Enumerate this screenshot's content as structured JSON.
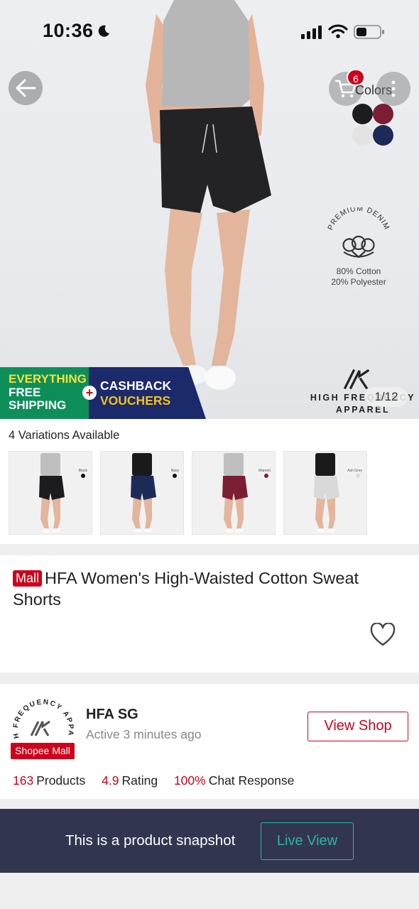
{
  "status_bar": {
    "time": "10:36",
    "icons": [
      "moon-icon",
      "signal-icon",
      "wifi-icon",
      "battery-icon"
    ]
  },
  "hero": {
    "cart_badge": "6",
    "colors_label": "Colors",
    "swatches": [
      {
        "name": "Black",
        "color": "#1c1c1e"
      },
      {
        "name": "Maroon",
        "color": "#7b1e33"
      },
      {
        "name": "Ash Grey",
        "color": "#e3e3e3"
      },
      {
        "name": "Navy",
        "color": "#1d2a57"
      }
    ],
    "cotton_badge": {
      "arc_text": "PREMIUM DENIM",
      "lines": [
        "80% Cotton",
        "20% Polyester"
      ]
    },
    "promo": {
      "left_lines": [
        {
          "text": "EVERYTHING",
          "tone": "y"
        },
        {
          "text": "FREE",
          "tone": "w"
        },
        {
          "text": "SHIPPING",
          "tone": "w"
        }
      ],
      "right_lines": [
        {
          "text": "CASHBACK",
          "tone": "w"
        },
        {
          "text": "VOUCHERS",
          "tone": "y"
        }
      ]
    },
    "brand": {
      "name_line1": "HIGH FREQUENCY",
      "name_line2": "APPAREL"
    },
    "page_counter": "1/12"
  },
  "variations": {
    "title": "4 Variations Available",
    "items": [
      {
        "label": "Black",
        "top_color": "#bfbfbf",
        "short_color": "#1c1c1e",
        "dot": "#111111"
      },
      {
        "label": "Navy",
        "top_color": "#1a1a1a",
        "short_color": "#1d2a57",
        "dot": "#111111"
      },
      {
        "label": "Maroon",
        "top_color": "#bfbfbf",
        "short_color": "#7b1e33",
        "dot": "#7b1e33"
      },
      {
        "label": "Ash Grey",
        "top_color": "#1a1a1a",
        "short_color": "#d9d9d9",
        "dot": "#d9d9d9"
      }
    ]
  },
  "product": {
    "mall_badge": "Mall",
    "title": "HFA Women's High-Waisted Cotton Sweat Shorts"
  },
  "shop": {
    "avatar_arc_text": "HIGH FREQUENCY APPAREL",
    "mall_tag": "Shopee Mall",
    "name": "HFA SG",
    "active": "Active 3 minutes ago",
    "view_shop": "View Shop",
    "stats": [
      {
        "num": "163",
        "label": "Products"
      },
      {
        "num": "4.9",
        "label": "Rating"
      },
      {
        "num": "100%",
        "label": "Chat Response"
      }
    ]
  },
  "snapshot": {
    "text": "This is a product snapshot",
    "live_view": "Live View"
  },
  "colors": {
    "brand_red": "#d0011b",
    "snapshot_bar": "#323550",
    "live_view_teal": "#2bb5a0"
  }
}
